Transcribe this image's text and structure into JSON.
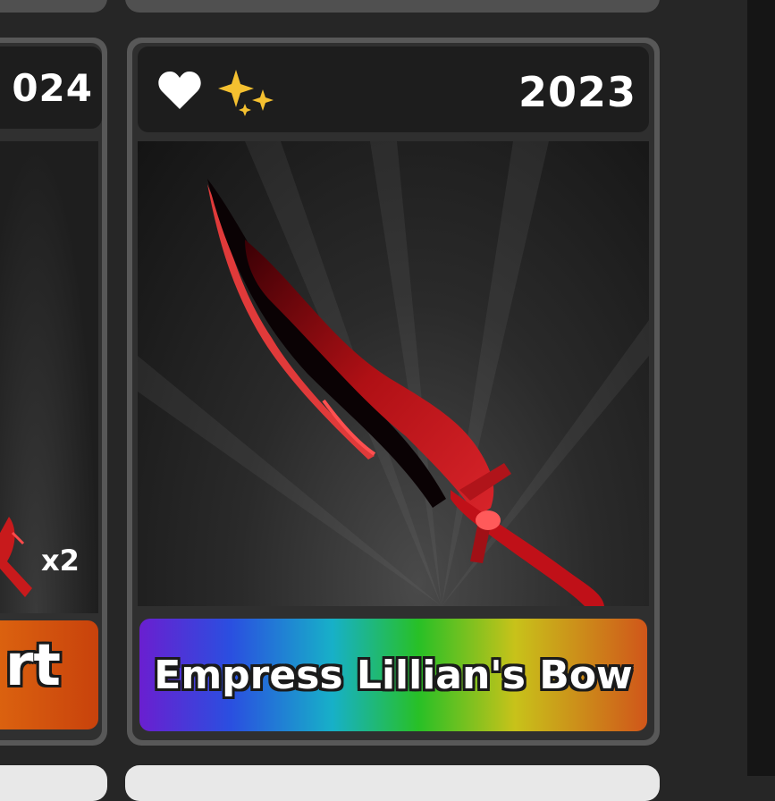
{
  "left_card": {
    "year_partial": "024",
    "qty_label": "x2",
    "name_partial": "rt",
    "label_color": "#d4571c"
  },
  "main_card": {
    "year": "2023",
    "favorite_icon": "heart-icon",
    "sparkle_icon": "sparkle-icon",
    "item_name": "Empress Lillian's Bow",
    "rarity_gradient": [
      "#6a1fd0",
      "#2a4fe0",
      "#17b0c8",
      "#28c026",
      "#c8c21a",
      "#d0561a"
    ],
    "blade_color": "#c2121a"
  },
  "icons": {
    "heart": "heart-icon",
    "sparkle": "sparkle-icon"
  }
}
